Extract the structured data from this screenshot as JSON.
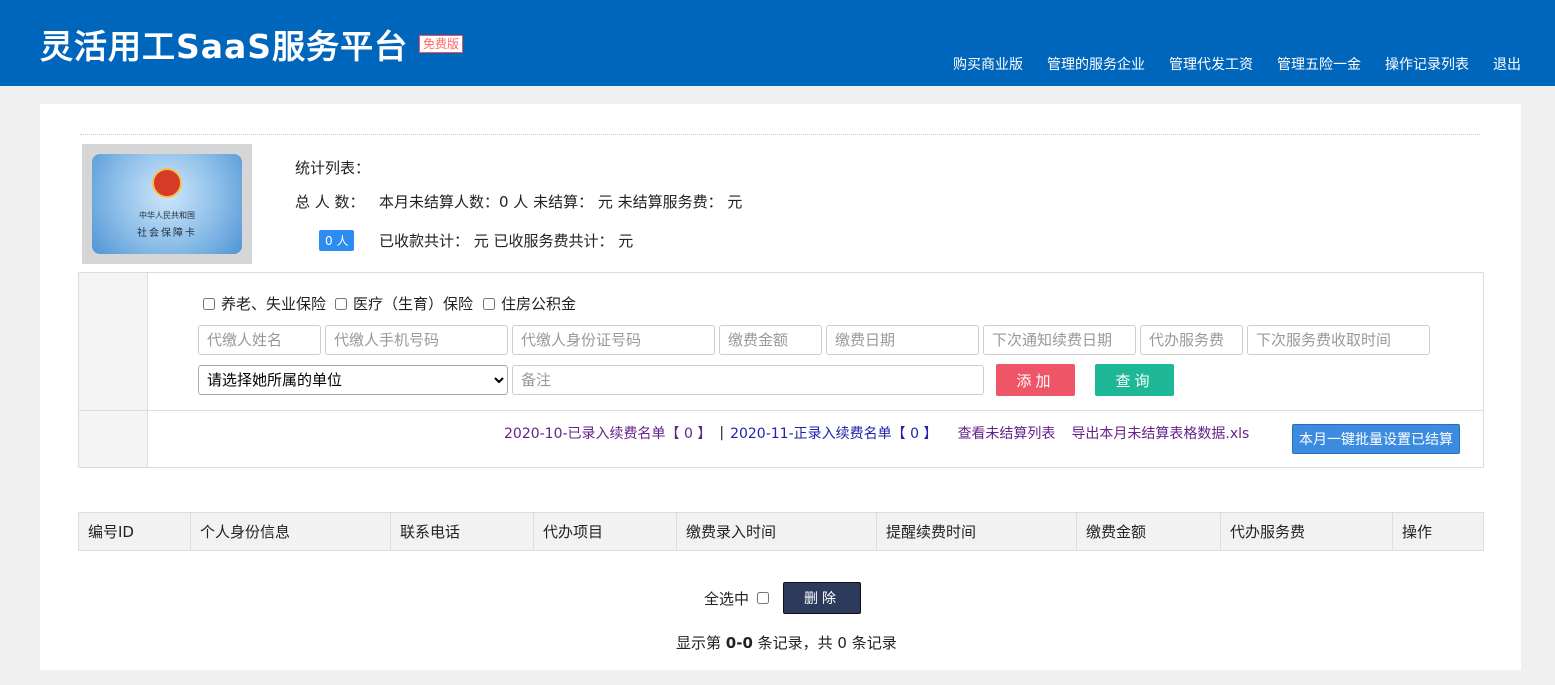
{
  "header": {
    "brand": "灵活用工SaaS服务平台",
    "badge": "免费版",
    "nav": [
      "购买商业版",
      "管理的服务企业",
      "管理代发工资",
      "管理五险一金",
      "操作记录列表",
      "退出"
    ]
  },
  "card": {
    "line1": "中华人民共和国",
    "line2": "社会保障卡"
  },
  "stats": {
    "title": "统计列表：",
    "total_label": "总 人 数：",
    "total_count": "0 人",
    "row1": "本月未结算人数：0 人  未结算： 元  未结算服务费： 元",
    "row2": "已收款共计： 元  已收服务费共计： 元"
  },
  "form": {
    "checkboxes": [
      "养老、失业保险",
      "医疗（生育）保险",
      "住房公积金"
    ],
    "placeholders": {
      "name": "代缴人姓名",
      "phone": "代缴人手机号码",
      "idcard": "代缴人身份证号码",
      "amount": "缴费金额",
      "date": "缴费日期",
      "next_notice": "下次通知续费日期",
      "service_fee": "代办服务费",
      "next_fee_time": "下次服务费收取时间",
      "remark": "备注"
    },
    "unit_select": "请选择她所属的单位",
    "add_label": "添加",
    "search_label": "查询"
  },
  "links": {
    "oct_list": "2020-10-已录入续费名单【 0 】",
    "separator": "|",
    "nov_list": "2020-11-正录入续费名单【 0 】",
    "view_unsettled": "查看未结算列表",
    "export": "导出本月未结算表格数据.xls",
    "batch_settle": "本月一键批量设置已结算"
  },
  "table": {
    "headers": [
      "编号ID",
      "个人身份信息",
      "联系电话",
      "代办项目",
      "缴费录入时间",
      "提醒续费时间",
      "缴费金额",
      "代办服务费",
      "操作"
    ]
  },
  "bottom": {
    "select_all": "全选中",
    "delete_label": "删除",
    "pager_prefix": "显示第 ",
    "pager_range": "0-0",
    "pager_suffix": " 条记录，共 0 条记录"
  },
  "colors": {
    "header_bg": "#0066bb",
    "add": "#ee5566",
    "search": "#1fb896",
    "batch": "#3b8be0",
    "delete": "#2e3a5c"
  }
}
